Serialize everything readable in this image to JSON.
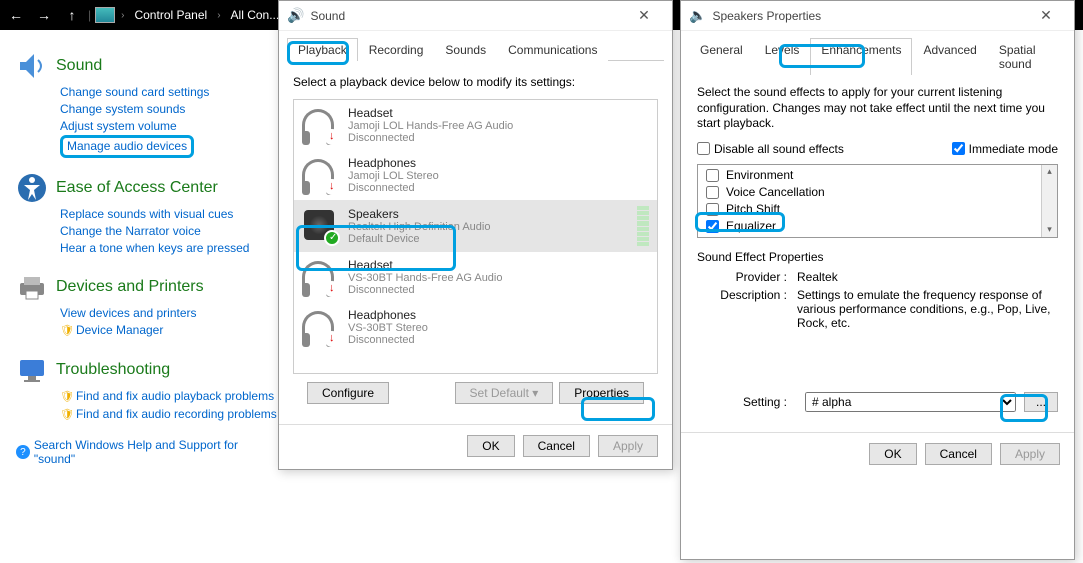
{
  "nav": {
    "crumb1": "Control Panel",
    "crumb2": "All Con..."
  },
  "cp": {
    "sound": {
      "title": "Sound",
      "links": [
        "Change sound card settings",
        "Change system sounds",
        "Adjust system volume",
        "Manage audio devices"
      ]
    },
    "ease": {
      "title": "Ease of Access Center",
      "links": [
        "Replace sounds with visual cues",
        "Change the Narrator voice",
        "Hear a tone when keys are pressed"
      ]
    },
    "dev": {
      "title": "Devices and Printers",
      "links": [
        "View devices and printers",
        "Device Manager"
      ]
    },
    "trouble": {
      "title": "Troubleshooting",
      "links": [
        "Find and fix audio playback problems",
        "Find and fix audio recording problems"
      ]
    },
    "search": "Search Windows Help and Support for \"sound\""
  },
  "sound_dlg": {
    "title": "Sound",
    "tabs": [
      "Playback",
      "Recording",
      "Sounds",
      "Communications"
    ],
    "instr": "Select a playback device below to modify its settings:",
    "devices": [
      {
        "name": "Headset",
        "sub1": "Jamoji LOL Hands-Free AG Audio",
        "sub2": "Disconnected",
        "icon": "hp",
        "ovl": "red"
      },
      {
        "name": "Headphones",
        "sub1": "Jamoji LOL Stereo",
        "sub2": "Disconnected",
        "icon": "hp",
        "ovl": "red"
      },
      {
        "name": "Speakers",
        "sub1": "Realtek High Definition Audio",
        "sub2": "Default Device",
        "icon": "spk",
        "ovl": "green"
      },
      {
        "name": "Headset",
        "sub1": "VS-30BT Hands-Free AG Audio",
        "sub2": "Disconnected",
        "icon": "hp",
        "ovl": "red"
      },
      {
        "name": "Headphones",
        "sub1": "VS-30BT Stereo",
        "sub2": "Disconnected",
        "icon": "hp",
        "ovl": "red"
      }
    ],
    "configure": "Configure",
    "setdefault": "Set Default",
    "properties": "Properties",
    "ok": "OK",
    "cancel": "Cancel",
    "apply": "Apply"
  },
  "props_dlg": {
    "title": "Speakers Properties",
    "tabs": [
      "General",
      "Levels",
      "Enhancements",
      "Advanced",
      "Spatial sound"
    ],
    "desc": "Select the sound effects to apply for your current listening configuration. Changes may not take effect until the next time you start playback.",
    "disable_all": "Disable all sound effects",
    "immediate": "Immediate mode",
    "fx": [
      "Environment",
      "Voice Cancellation",
      "Pitch Shift",
      "Equalizer"
    ],
    "sect": "Sound Effect Properties",
    "provider_lbl": "Provider :",
    "provider": "Realtek",
    "desc_lbl": "Description :",
    "desc_val": "Settings to emulate the frequency response of various performance conditions,  e.g., Pop, Live, Rock, etc.",
    "setting_lbl": "Setting :",
    "setting_val": "# alpha",
    "ellipsis": "...",
    "ok": "OK",
    "cancel": "Cancel",
    "apply": "Apply"
  }
}
